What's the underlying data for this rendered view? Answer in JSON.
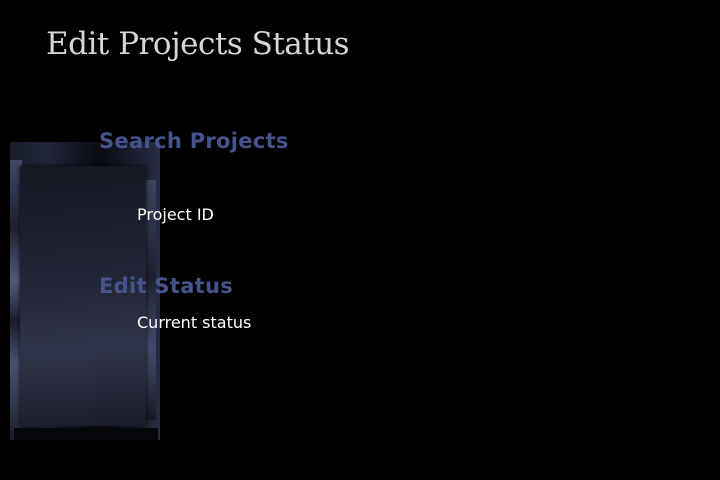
{
  "page": {
    "title": "Edit Projects Status"
  },
  "search": {
    "heading": "Search Projects",
    "project_id_label": "Project ID"
  },
  "edit": {
    "heading": "Edit Status",
    "current_status_label": "Current status"
  },
  "colors": {
    "background": "#000000",
    "title": "#d8d6d4",
    "section_heading": "#46548e",
    "label": "#ffffff"
  },
  "icons": {
    "decor": "decorative-image"
  }
}
